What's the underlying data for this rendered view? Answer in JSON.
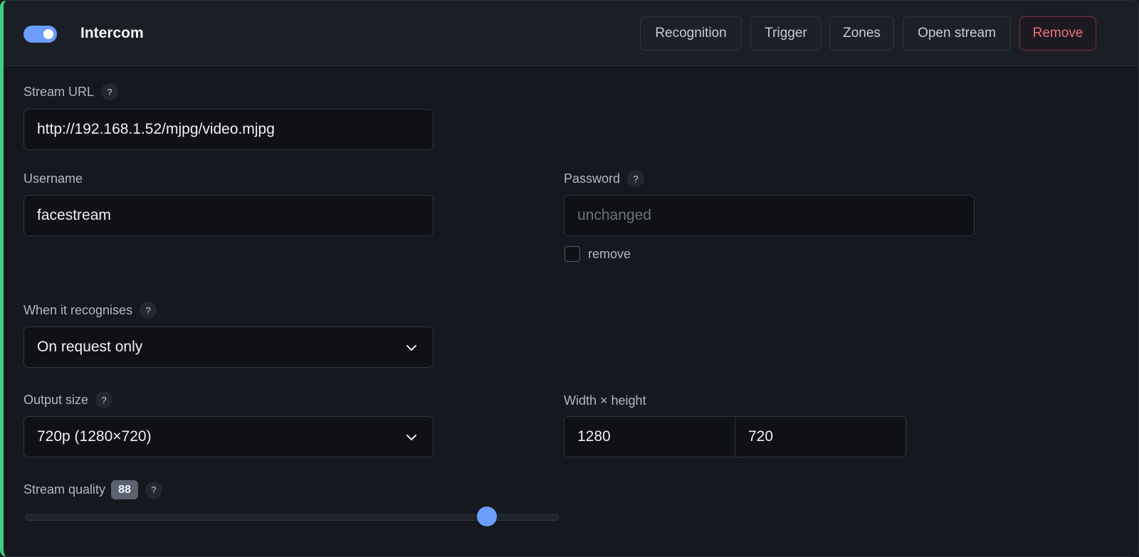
{
  "card": {
    "title": "Intercom",
    "enabled": true,
    "accent_color": "#3ecf7a",
    "toggle_color": "#6b9dfc"
  },
  "header_buttons": {
    "recognition": "Recognition",
    "trigger": "Trigger",
    "zones": "Zones",
    "open_stream": "Open stream",
    "remove": "Remove"
  },
  "stream_url": {
    "label": "Stream URL",
    "help": "?",
    "value": "http://192.168.1.52/mjpg/video.mjpg"
  },
  "username": {
    "label": "Username",
    "value": "facestream"
  },
  "password": {
    "label": "Password",
    "help": "?",
    "placeholder": "unchanged",
    "remove_label": "remove",
    "remove_checked": false
  },
  "recognition_mode": {
    "label": "When it recognises",
    "help": "?",
    "selected": "On request only",
    "icon": "chevron-down-icon"
  },
  "output_size": {
    "label": "Output size",
    "help": "?",
    "selected": "720p (1280×720)",
    "icon": "chevron-down-icon"
  },
  "dimensions": {
    "label": "Width × height",
    "width": "1280",
    "height": "720"
  },
  "stream_quality": {
    "label": "Stream quality",
    "value": "88",
    "help": "?",
    "slider_fraction": 0.88
  }
}
